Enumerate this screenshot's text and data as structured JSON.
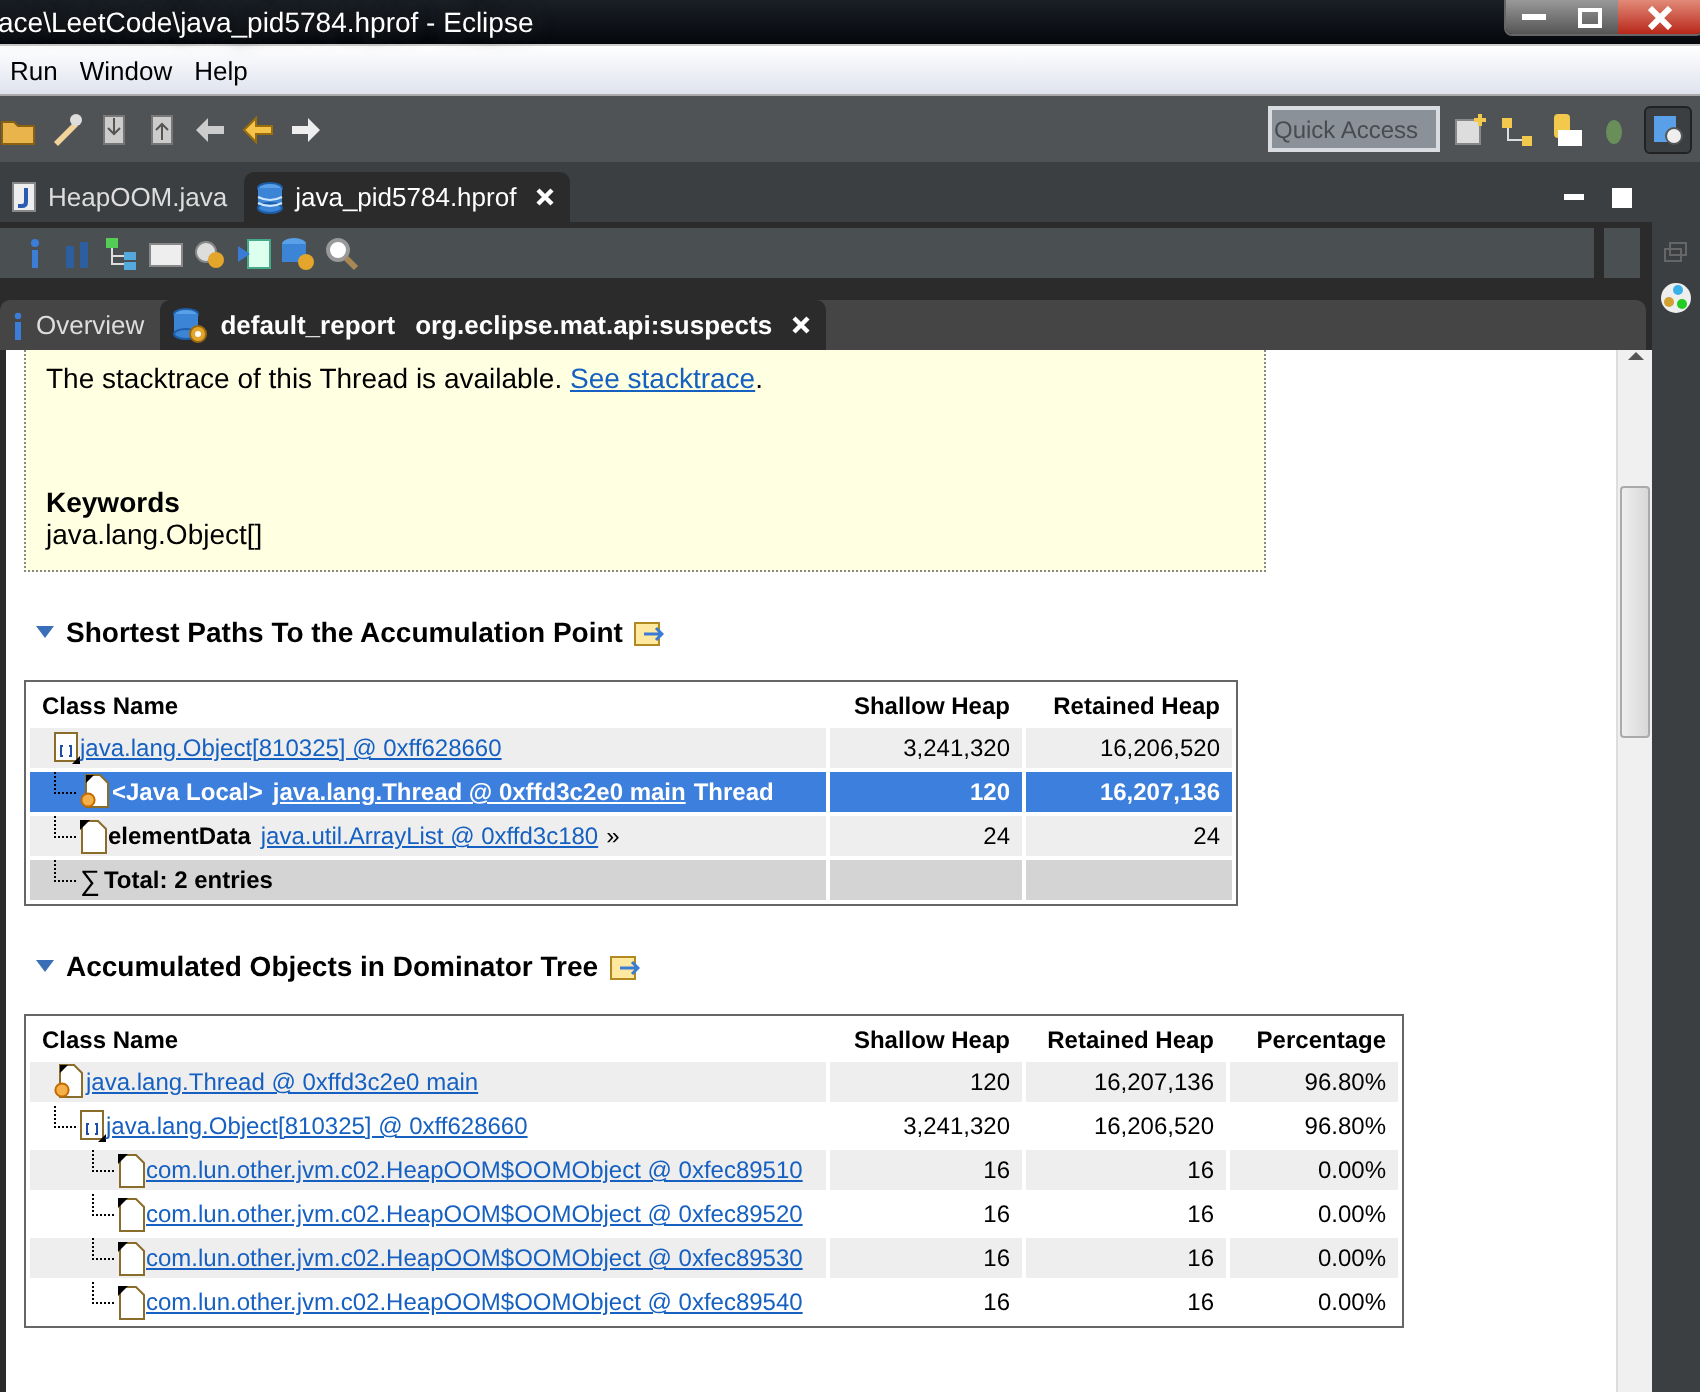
{
  "window": {
    "title": "ace\\LeetCode\\java_pid5784.hprof - Eclipse"
  },
  "menu": [
    "Run",
    "Window",
    "Help"
  ],
  "quick_access": {
    "placeholder": "Quick Access"
  },
  "editor_tabs": [
    {
      "label": "HeapOOM.java",
      "kind": "java",
      "selected": false,
      "closable": false
    },
    {
      "label": "java_pid5784.hprof",
      "kind": "heap",
      "selected": true,
      "closable": true
    }
  ],
  "report_tabs": [
    {
      "label": "Overview",
      "kind": "info",
      "selected": false,
      "closable": false
    },
    {
      "label": "default_report",
      "detail": "org.eclipse.mat.api:suspects",
      "kind": "report",
      "selected": true,
      "closable": true
    }
  ],
  "note": {
    "text": "The stacktrace of this Thread is available.",
    "link": "See stacktrace",
    "end": ".",
    "keywords_heading": "Keywords",
    "keywords": "java.lang.Object[]"
  },
  "sections": [
    {
      "title": "Shortest Paths To the Accumulation Point",
      "table": {
        "columns": [
          "Class Name",
          "Shallow Heap",
          "Retained Heap"
        ],
        "rows": [
          {
            "kind": "array",
            "link": "java.lang.Object[810325] @ 0xff628660",
            "values": [
              "3,241,320",
              "16,206,520"
            ],
            "selected": false,
            "children": [
              {
                "kind": "thread",
                "prefix": "<Java Local>",
                "link": "java.lang.Thread @ 0xffd3c2e0 main",
                "suffix": "Thread",
                "values": [
                  "120",
                  "16,207,136"
                ],
                "selected": true
              },
              {
                "kind": "object",
                "prefix": "elementData",
                "link": "java.util.ArrayList @ 0xffd3c180",
                "suffix": "»",
                "values": [
                  "24",
                  "24"
                ],
                "selected": false
              },
              {
                "kind": "total",
                "symbol": "∑",
                "prefix": "Total: 2 entries",
                "selected": false
              }
            ]
          }
        ]
      }
    },
    {
      "title": "Accumulated Objects in Dominator Tree",
      "table": {
        "columns": [
          "Class Name",
          "Shallow Heap",
          "Retained Heap",
          "Percentage"
        ],
        "rows": [
          {
            "kind": "thread",
            "link": "java.lang.Thread @ 0xffd3c2e0 main",
            "values": [
              "120",
              "16,207,136",
              "96.80%"
            ],
            "selected": false,
            "children": [
              {
                "kind": "array",
                "link": "java.lang.Object[810325] @ 0xff628660",
                "values": [
                  "3,241,320",
                  "16,206,520",
                  "96.80%"
                ],
                "selected": false,
                "children": [
                  {
                    "kind": "object",
                    "link": "com.lun.other.jvm.c02.HeapOOM$OOMObject @ 0xfec89510",
                    "values": [
                      "16",
                      "16",
                      "0.00%"
                    ],
                    "selected": false
                  },
                  {
                    "kind": "object",
                    "link": "com.lun.other.jvm.c02.HeapOOM$OOMObject @ 0xfec89520",
                    "values": [
                      "16",
                      "16",
                      "0.00%"
                    ],
                    "selected": false
                  },
                  {
                    "kind": "object",
                    "link": "com.lun.other.jvm.c02.HeapOOM$OOMObject @ 0xfec89530",
                    "values": [
                      "16",
                      "16",
                      "0.00%"
                    ],
                    "selected": false
                  },
                  {
                    "kind": "object",
                    "link": "com.lun.other.jvm.c02.HeapOOM$OOMObject @ 0xfec89540",
                    "values": [
                      "16",
                      "16",
                      "0.00%"
                    ],
                    "selected": false
                  }
                ]
              }
            ]
          }
        ]
      }
    }
  ]
}
